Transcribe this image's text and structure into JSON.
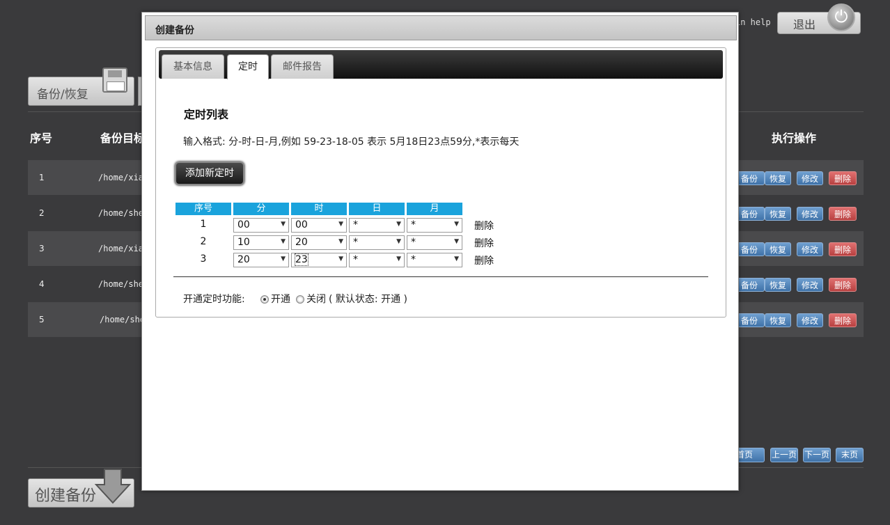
{
  "topbar": {
    "help_text": "in help",
    "logout_label": "退出"
  },
  "toolbar": {
    "backup_restore_label": "备份/恢复",
    "create_backup_label": "创建备份"
  },
  "table": {
    "headers": {
      "seq": "序号",
      "target": "备份目标",
      "actions": "执行操作"
    },
    "rows": [
      {
        "num": "1",
        "path": "/home/xia"
      },
      {
        "num": "2",
        "path": "/home/she"
      },
      {
        "num": "3",
        "path": "/home/xia"
      },
      {
        "num": "4",
        "path": "/home/she"
      },
      {
        "num": "5",
        "path": "/home/she"
      }
    ],
    "action_labels": {
      "backup": "备份",
      "restore": "恢复",
      "edit": "修改",
      "delete": "删除"
    }
  },
  "pager": {
    "first": "首页",
    "prev": "上一页",
    "next": "下一页",
    "last": "末页"
  },
  "modal": {
    "title": "创建备份",
    "tabs": [
      "基本信息",
      "定时",
      "邮件报告"
    ],
    "active_tab": "定时",
    "section_title": "定时列表",
    "format_text": "输入格式: 分-时-日-月,例如 59-23-18-05 表示 5月18日23点59分,*表示每天",
    "add_button": "添加新定时",
    "schedule_headers": [
      "序号",
      "分",
      "时",
      "日",
      "月"
    ],
    "schedules": [
      {
        "seq": "1",
        "minute": "00",
        "hour": "00",
        "day": "*",
        "month": "*"
      },
      {
        "seq": "2",
        "minute": "10",
        "hour": "20",
        "day": "*",
        "month": "*"
      },
      {
        "seq": "3",
        "minute": "20",
        "hour": "23",
        "day": "*",
        "month": "*"
      }
    ],
    "delete_label": "删除",
    "enable_label": "开通定时功能:",
    "radio_on": "开通",
    "radio_off": "关闭",
    "default_note": "( 默认状态: 开通 )"
  },
  "colors": {
    "header_blue": "#1aa3dc",
    "action_blue": "#3f72a8",
    "action_red": "#b84040"
  }
}
